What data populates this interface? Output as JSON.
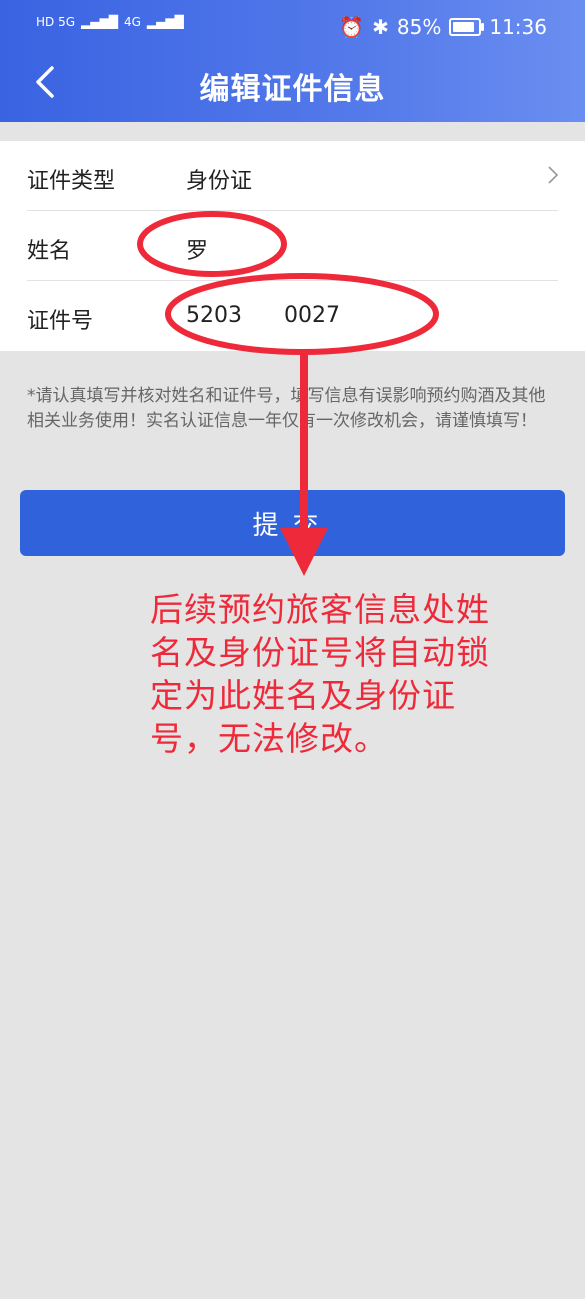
{
  "status_bar": {
    "signal_left": "HD 5G",
    "signal_right": "4G",
    "battery": "85%",
    "time": "11:36",
    "battery_level": 0.85
  },
  "header": {
    "title": "编辑证件信息"
  },
  "form": {
    "rows": [
      {
        "label": "证件类型",
        "value": "身份证"
      },
      {
        "label": "姓名",
        "value": "罗"
      },
      {
        "label": "证件号",
        "value": "5203      0027"
      }
    ]
  },
  "notice": "*请认真填写并核对姓名和证件号，填写信息有误影响预约购酒及其他相关业务使用！实名认证信息一年仅有一次修改机会，请谨慎填写！",
  "submit_label": "提交",
  "annotation": "后续预约旅客信息处姓名及身份证号将自动锁定为此姓名及身份证号，无法修改。",
  "colors": {
    "header": "#3a63e2",
    "button": "#3063db",
    "annotation": "#ee2a3a"
  },
  "icons": [
    "back-arrow-icon",
    "chevron-right-icon",
    "alarm-icon",
    "bluetooth-icon",
    "battery-icon"
  ]
}
